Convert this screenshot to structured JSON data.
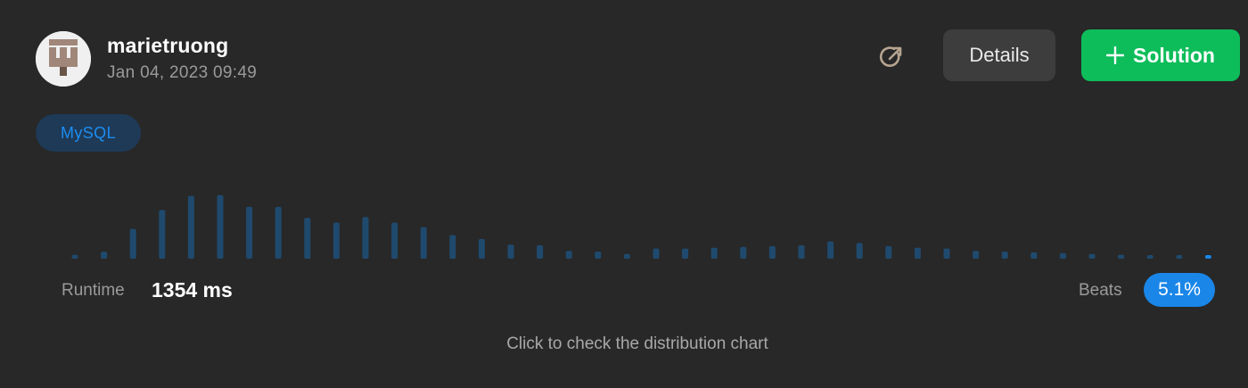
{
  "submission": {
    "username": "marietruong",
    "timestamp": "Jan 04, 2023 09:49",
    "language_tag": "MySQL"
  },
  "actions": {
    "share_icon": "share-arrow-icon",
    "details_label": "Details",
    "solution_label": "Solution",
    "solution_icon": "plus-icon"
  },
  "stats": {
    "runtime_label": "Runtime",
    "runtime_value": "1354 ms",
    "beats_label": "Beats",
    "beats_value": "5.1%"
  },
  "hint": "Click to check the distribution chart",
  "colors": {
    "background": "#282828",
    "bar": "#1f4a6e",
    "current_bar": "#1a86e8",
    "solution_button": "#0dbd5a",
    "details_button": "#3d3d3d",
    "badge": "#1a86e8"
  },
  "chart_data": {
    "type": "bar",
    "values": [
      0.05,
      0.09,
      0.38,
      0.62,
      0.8,
      0.81,
      0.66,
      0.66,
      0.52,
      0.46,
      0.53,
      0.46,
      0.4,
      0.3,
      0.25,
      0.18,
      0.17,
      0.1,
      0.09,
      0.06,
      0.13,
      0.13,
      0.14,
      0.15,
      0.16,
      0.17,
      0.22,
      0.2,
      0.16,
      0.14,
      0.13,
      0.1,
      0.09,
      0.08,
      0.07,
      0.06,
      0.05,
      0.04,
      0.04,
      0.04
    ],
    "current_index": 39
  }
}
